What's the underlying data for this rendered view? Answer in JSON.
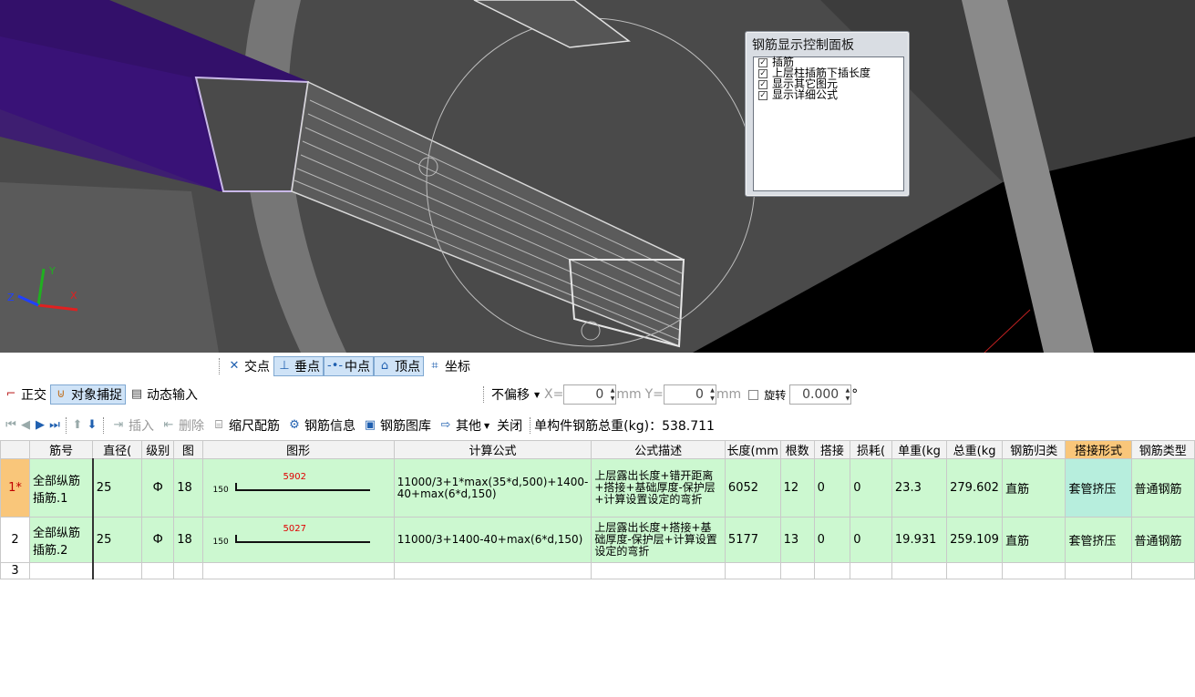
{
  "panel": {
    "title": "钢筋显示控制面板",
    "options": [
      {
        "label": "插筋",
        "checked": true
      },
      {
        "label": "上层柱插筋下插长度",
        "checked": true
      },
      {
        "label": "显示其它图元",
        "checked": true
      },
      {
        "label": "显示详细公式",
        "checked": true
      }
    ]
  },
  "snap_toolbar": {
    "intersection": "交点",
    "perpendicular": "垂点",
    "midpoint": "中点",
    "vertex": "顶点",
    "coordinate": "坐标"
  },
  "status_toolbar": {
    "ortho": "正交",
    "object_snap": "对象捕捉",
    "dynamic_input": "动态输入",
    "offset_mode": "不偏移",
    "x_label": "X=",
    "x_value": "0",
    "y_label": "Y=",
    "y_value": "0",
    "unit": "mm",
    "rotate_label": "旋转",
    "rotate_value": "0.000",
    "degree": "°"
  },
  "grid_toolbar": {
    "insert": "插入",
    "delete": "删除",
    "scale_rebar": "缩尺配筋",
    "rebar_info": "钢筋信息",
    "rebar_library": "钢筋图库",
    "other": "其他",
    "close": "关闭",
    "total_weight": "单构件钢筋总重(kg)：538.711"
  },
  "table": {
    "headers": [
      "筋号",
      "直径(",
      "级别",
      "图",
      "图形",
      "计算公式",
      "公式描述",
      "长度(mm",
      "根数",
      "搭接",
      "损耗(",
      "单重(kg",
      "总重(kg",
      "钢筋归类",
      "搭接形式",
      "钢筋类型"
    ],
    "rows": [
      {
        "num": "1*",
        "name": "全部纵筋插筋.1",
        "diameter": "25",
        "grade": "Ф",
        "figure": "18",
        "shape_side": "150",
        "shape_length": "5902",
        "formula": "11000/3+1*max(35*d,500)+1400-40+max(6*d,150)",
        "description": "上层露出长度+错开距离+搭接+基础厚度-保护层+计算设置设定的弯折",
        "length": "6052",
        "count": "12",
        "lap": "0",
        "loss": "0",
        "unit_weight": "23.3",
        "total_weight": "279.602",
        "category": "直筋",
        "lap_type": "套管挤压",
        "rebar_type": "普通钢筋"
      },
      {
        "num": "2",
        "name": "全部纵筋插筋.2",
        "diameter": "25",
        "grade": "Ф",
        "figure": "18",
        "shape_side": "150",
        "shape_length": "5027",
        "formula": "11000/3+1400-40+max(6*d,150)",
        "description": "上层露出长度+搭接+基础厚度-保护层+计算设置设定的弯折",
        "length": "5177",
        "count": "13",
        "lap": "0",
        "loss": "0",
        "unit_weight": "19.931",
        "total_weight": "259.109",
        "category": "直筋",
        "lap_type": "套管挤压",
        "rebar_type": "普通钢筋"
      },
      {
        "num": "3"
      }
    ]
  }
}
